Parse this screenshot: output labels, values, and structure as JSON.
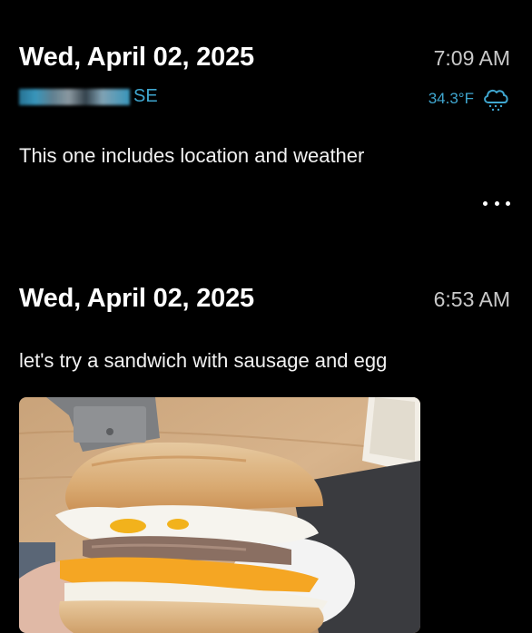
{
  "entries": [
    {
      "date": "Wed, April 02, 2025",
      "time": "7:09 AM",
      "location": {
        "visible_text": "SE"
      },
      "weather": {
        "temperature": "34.3°F",
        "icon": "rain-cloud-icon"
      },
      "text": "This one includes location and weather",
      "more_icon": "ellipsis-icon"
    },
    {
      "date": "Wed, April 02, 2025",
      "time": "6:53 AM",
      "text": "let's try a sandwich with sausage and egg",
      "photo": {
        "subject": "sausage-egg-cheese-sandwich"
      }
    }
  ],
  "colors": {
    "background": "#000000",
    "primary_text": "#ffffff",
    "secondary_text": "#c9c9c9",
    "accent": "#3fa6cf"
  }
}
